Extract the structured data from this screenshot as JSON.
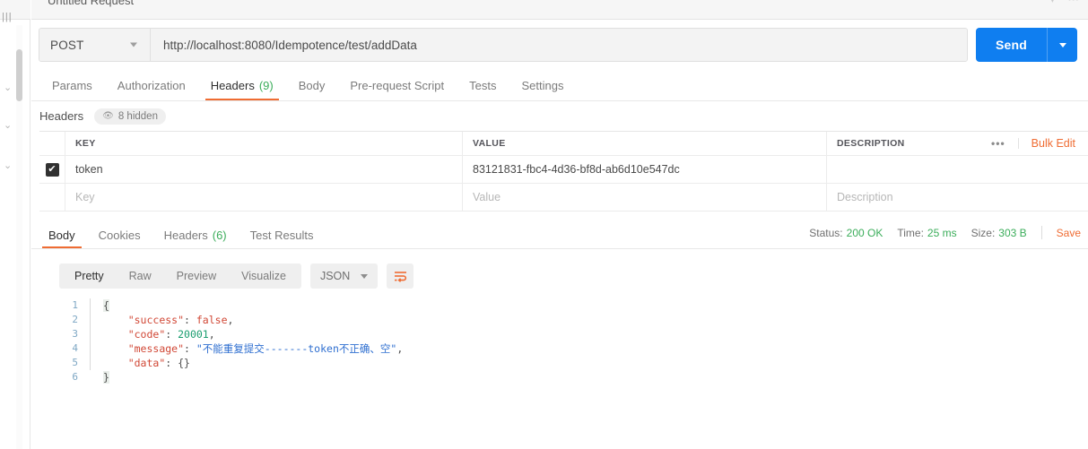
{
  "window": {
    "request_title": "Untitled Request"
  },
  "left_strip": {
    "glyphs": [
      "|||",
      "⌄",
      "⌄",
      "⌄"
    ]
  },
  "url_bar": {
    "method": "POST",
    "url": "http://localhost:8080/Idempotence/test/addData",
    "send_label": "Send"
  },
  "request_tabs": [
    {
      "label": "Params",
      "count": "",
      "active": false
    },
    {
      "label": "Authorization",
      "count": "",
      "active": false
    },
    {
      "label": "Headers",
      "count": "(9)",
      "active": true
    },
    {
      "label": "Body",
      "count": "",
      "active": false
    },
    {
      "label": "Pre-request Script",
      "count": "",
      "active": false
    },
    {
      "label": "Tests",
      "count": "",
      "active": false
    },
    {
      "label": "Settings",
      "count": "",
      "active": false
    }
  ],
  "headers_section": {
    "title": "Headers",
    "hidden_label": "8 hidden",
    "eye_icon": "eye-icon",
    "columns": [
      "KEY",
      "VALUE",
      "DESCRIPTION"
    ],
    "more_actions": "•••",
    "bulk_edit": "Bulk Edit",
    "rows": [
      {
        "checked": true,
        "check_glyph": "✔",
        "key": "token",
        "value": "83121831-fbc4-4d36-bf8d-ab6d10e547dc",
        "description": ""
      }
    ],
    "empty_row": {
      "key_placeholder": "Key",
      "value_placeholder": "Value",
      "description_placeholder": "Description"
    }
  },
  "response_tabs": [
    {
      "label": "Body",
      "count": "",
      "active": true
    },
    {
      "label": "Cookies",
      "count": "",
      "active": false
    },
    {
      "label": "Headers",
      "count": "(6)",
      "active": false
    },
    {
      "label": "Test Results",
      "count": "",
      "active": false
    }
  ],
  "response_meta": {
    "status_label": "Status:",
    "status_value": "200 OK",
    "time_label": "Time:",
    "time_value": "25 ms",
    "size_label": "Size:",
    "size_value": "303 B",
    "save_label": "Save"
  },
  "body_toolbar": {
    "views": [
      {
        "label": "Pretty",
        "active": true
      },
      {
        "label": "Raw",
        "active": false
      },
      {
        "label": "Preview",
        "active": false
      },
      {
        "label": "Visualize",
        "active": false
      }
    ],
    "format": "JSON",
    "wrap_icon": "word-wrap-icon"
  },
  "response_body": {
    "language": "json",
    "lines": [
      {
        "num": "1",
        "fold": true,
        "tokens": [
          {
            "t": "{",
            "c": "tk-brace"
          }
        ]
      },
      {
        "num": "2",
        "fold": true,
        "tokens": [
          {
            "t": "    ",
            "c": "tk-punct"
          },
          {
            "t": "\"success\"",
            "c": "tk-key"
          },
          {
            "t": ": ",
            "c": "tk-punct"
          },
          {
            "t": "false",
            "c": "tk-bool"
          },
          {
            "t": ",",
            "c": "tk-punct"
          }
        ]
      },
      {
        "num": "3",
        "fold": true,
        "tokens": [
          {
            "t": "    ",
            "c": "tk-punct"
          },
          {
            "t": "\"code\"",
            "c": "tk-key"
          },
          {
            "t": ": ",
            "c": "tk-punct"
          },
          {
            "t": "20001",
            "c": "tk-num"
          },
          {
            "t": ",",
            "c": "tk-punct"
          }
        ]
      },
      {
        "num": "4",
        "fold": true,
        "tokens": [
          {
            "t": "    ",
            "c": "tk-punct"
          },
          {
            "t": "\"message\"",
            "c": "tk-key"
          },
          {
            "t": ": ",
            "c": "tk-punct"
          },
          {
            "t": "\"不能重复提交-------token不正确、空\"",
            "c": "tk-str"
          },
          {
            "t": ",",
            "c": "tk-punct"
          }
        ]
      },
      {
        "num": "5",
        "fold": true,
        "tokens": [
          {
            "t": "    ",
            "c": "tk-punct"
          },
          {
            "t": "\"data\"",
            "c": "tk-key"
          },
          {
            "t": ": ",
            "c": "tk-punct"
          },
          {
            "t": "{}",
            "c": "tk-punct"
          }
        ]
      },
      {
        "num": "6",
        "fold": false,
        "tokens": [
          {
            "t": "}",
            "c": "tk-brace"
          }
        ]
      }
    ]
  },
  "colors": {
    "accent_orange": "#ef6c33",
    "send_blue": "#0f7ef0",
    "success_green": "#3bad5a",
    "string_blue": "#2f6fd0",
    "key_red": "#d14836",
    "number_green": "#1a9d6f"
  }
}
